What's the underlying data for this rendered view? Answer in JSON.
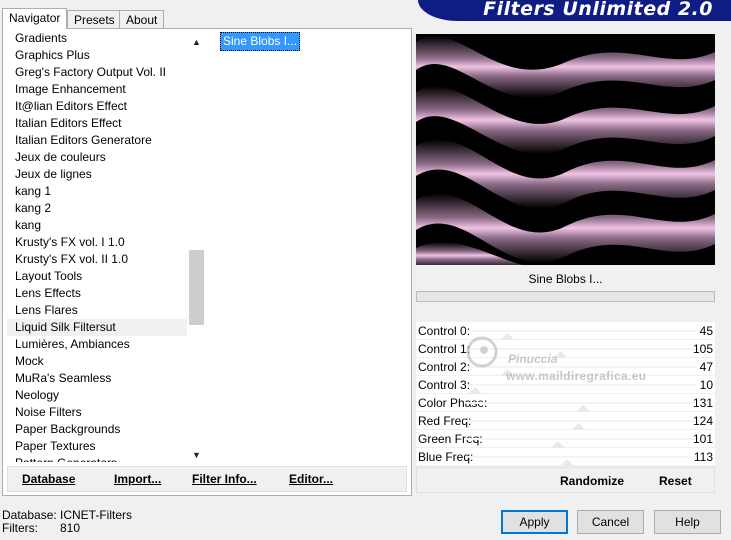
{
  "banner": {
    "title": "Filters Unlimited 2.0"
  },
  "tabs": [
    {
      "label": "Navigator",
      "active": true
    },
    {
      "label": "Presets",
      "active": false
    },
    {
      "label": "About",
      "active": false
    }
  ],
  "categories": [
    "Gradients",
    "Graphics Plus",
    "Greg's Factory Output Vol. II",
    "Image Enhancement",
    "It@lian Editors Effect",
    "Italian Editors Effect",
    "Italian Editors Generatore",
    "Jeux de couleurs",
    "Jeux de lignes",
    "kang 1",
    "kang 2",
    "kang",
    "Krusty's FX vol. I 1.0",
    "Krusty's FX vol. II 1.0",
    "Layout Tools",
    "Lens Effects",
    "Lens Flares",
    "Liquid Silk Filtersut",
    "Lumières, Ambiances",
    "Mock",
    "MuRa's Seamless",
    "Neology",
    "Noise Filters",
    "Paper Backgrounds",
    "Paper Textures",
    "Pattern Generators"
  ],
  "selected_category": "Liquid Silk Filtersut",
  "filters": [
    "Sine Blobs I..."
  ],
  "nav_buttons": {
    "database": "Database",
    "import": "Import...",
    "filter_info": "Filter Info...",
    "editor": "Editor..."
  },
  "preview": {
    "filter_name": "Sine Blobs I..."
  },
  "controls": [
    {
      "label": "Control 0:",
      "value": "45",
      "level": 0.18
    },
    {
      "label": "Control 1:",
      "value": "105",
      "level": 0.41
    },
    {
      "label": "Control 2:",
      "value": "47",
      "level": 0.18
    },
    {
      "label": "Control 3:",
      "value": "10",
      "level": 0.04
    },
    {
      "label": "Color Phase:",
      "value": "131",
      "level": 0.51
    },
    {
      "label": "Red Freq:",
      "value": "124",
      "level": 0.49
    },
    {
      "label": "Green Freq:",
      "value": "101",
      "level": 0.4
    },
    {
      "label": "Blue Freq:",
      "value": "113",
      "level": 0.44
    }
  ],
  "right_buttons": {
    "randomize": "Randomize",
    "reset": "Reset"
  },
  "watermark": {
    "line1": "Pinuccia",
    "line2": "www.maildiregrafica.eu"
  },
  "status": {
    "database_label": "Database:",
    "database_value": "ICNET-Filters",
    "filters_label": "Filters:",
    "filters_value": "810"
  },
  "dialog_buttons": {
    "apply": "Apply",
    "cancel": "Cancel",
    "help": "Help"
  },
  "colors": {
    "banner": "#0e1c84",
    "selection": "#3399ff",
    "accent": "#0078d7",
    "preview_pink": "#e6b4d8"
  }
}
